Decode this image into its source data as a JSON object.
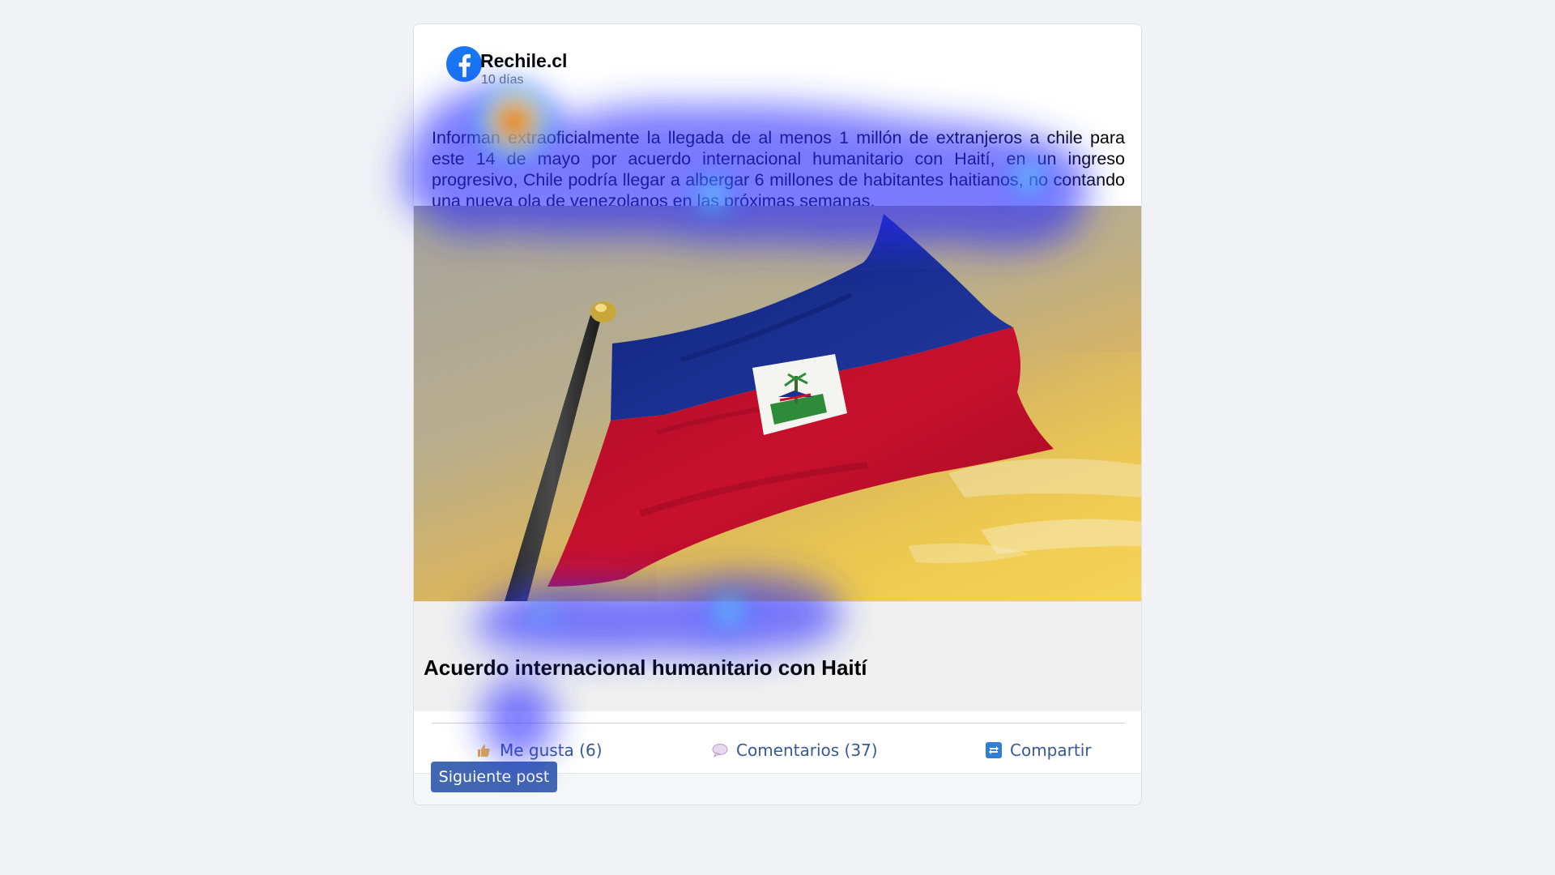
{
  "post": {
    "page_name": "Rechile.cl",
    "time": "10 días",
    "text": "Informan extraoficialmente la llegada de al menos 1 millón de extranjeros a chile para este 14 de mayo por acuerdo internacional humanitario con Haití, en un ingreso progresivo, Chile podría llegar a albergar 6 millones de habitantes haitianos, no contando una nueva ola de venezolanos en las próximas semanas.",
    "image_icon": "haiti-flag-photo",
    "link_title": "Acuerdo internacional humanitario con Haití"
  },
  "actions": {
    "like_label": "Me gusta (6)",
    "comment_label": "Comentarios (37)",
    "share_label": "Compartir"
  },
  "next_button_label": "Siguiente post",
  "colors": {
    "background": "#f0f2f5",
    "facebook_blue": "#1877f2",
    "action_text": "#385898",
    "button_bg": "#4267b2",
    "flag_blue": "#1a2f8f",
    "flag_red": "#c8102e"
  },
  "overlay": {
    "type": "attention-heatmap"
  }
}
